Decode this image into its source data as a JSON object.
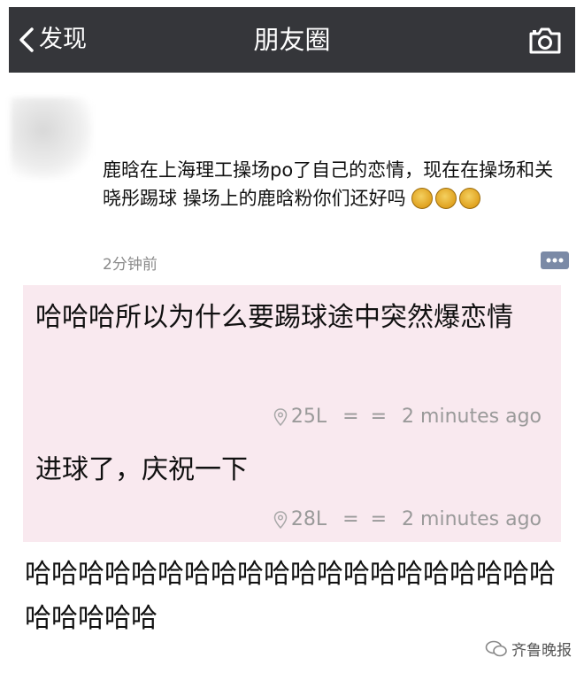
{
  "topbar": {
    "back_label": "发现",
    "title": "朋友圈"
  },
  "icons": {
    "back": "chevron-left-icon",
    "camera": "camera-icon",
    "comment": "comment-icon",
    "location": "location-pin-icon",
    "emoji": "emoji-icon",
    "watermark": "wechat-logo-icon"
  },
  "post": {
    "text": "鹿晗在上海理工操场po了自己的恋情，现在在操场和关晓彤踢球 操场上的鹿晗粉你们还好吗",
    "emoji_count": 3,
    "time": "2分钟前"
  },
  "replies": [
    {
      "text": "哈哈哈所以为什么要踢球途中突然爆恋情",
      "floor": "25L",
      "sep": "= =",
      "time": "2 minutes ago"
    },
    {
      "text": "进球了，庆祝一下",
      "floor": "28L",
      "sep": "= =",
      "time": "2 minutes ago"
    }
  ],
  "caption": "哈哈哈哈哈哈哈哈哈哈哈哈哈哈哈哈哈哈哈哈哈哈哈哈哈",
  "watermark": {
    "text": "齐鲁晚报"
  },
  "colors": {
    "topbar": "#35363a",
    "reply_bg": "#f9e9ef",
    "meta": "#9a9a9a"
  }
}
